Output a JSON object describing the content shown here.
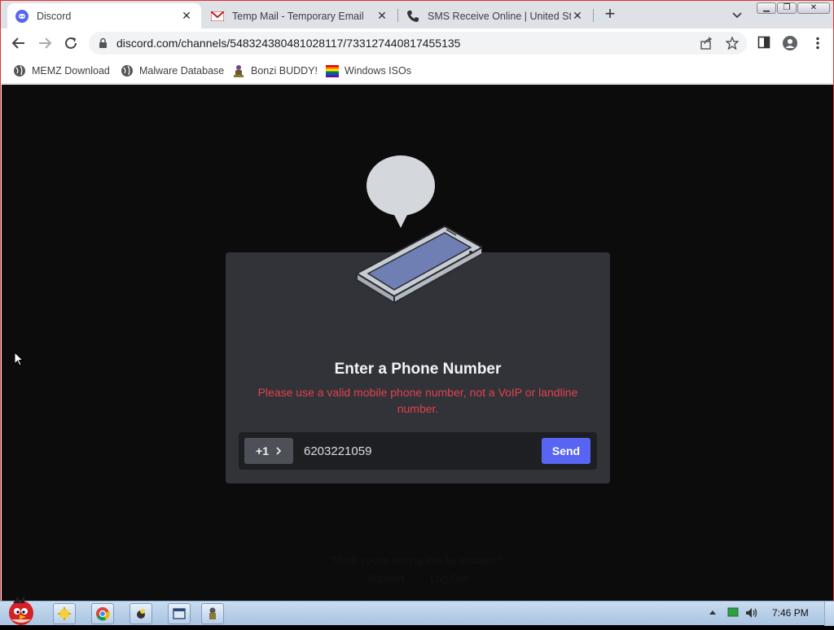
{
  "browser": {
    "tabs": [
      {
        "title": "Discord",
        "icon": "discord-icon",
        "active": true
      },
      {
        "title": "Temp Mail - Temporary Email",
        "icon": "gmail-icon",
        "active": false
      },
      {
        "title": "SMS Receive Online | United States",
        "icon": "phone-icon",
        "active": false
      }
    ],
    "url": "discord.com/channels/548324380481028117/733127440817455135",
    "bookmarks": [
      {
        "label": "MEMZ Download",
        "icon": "globe-icon"
      },
      {
        "label": "Malware Database",
        "icon": "globe-icon"
      },
      {
        "label": "Bonzi BUDDY!",
        "icon": "bonzi-icon"
      },
      {
        "label": "Windows ISOs",
        "icon": "windows-flag-icon"
      }
    ]
  },
  "background": {
    "mistake_text": "Think you're seeing this by mistake?",
    "support_link": "Support",
    "logout_link": "Log Out"
  },
  "modal": {
    "title": "Enter a Phone Number",
    "error": "Please use a valid mobile phone number, not a VoIP or landline number.",
    "country_code": "+1",
    "phone_value": "6203221059",
    "send_label": "Send"
  },
  "taskbar": {
    "clock": "7:46 PM"
  },
  "colors": {
    "modal_bg": "#313338",
    "error": "#e2414d",
    "send": "#5865f2"
  }
}
